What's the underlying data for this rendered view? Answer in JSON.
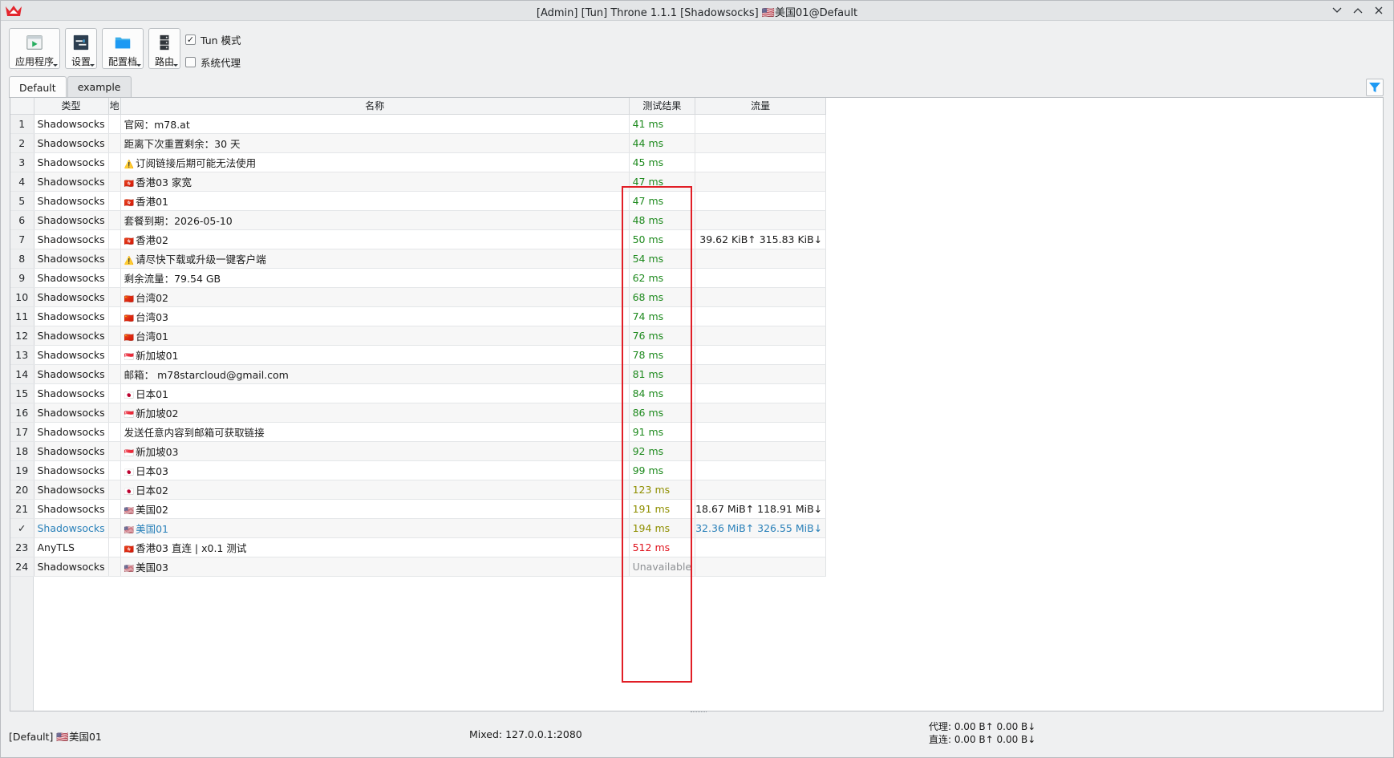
{
  "window": {
    "title": "[Admin] [Tun] Throne 1.1.1 [Shadowsocks] 🇺🇸美国01@Default"
  },
  "toolbar": {
    "buttons": [
      {
        "label": "应用程序",
        "icon": "play-icon"
      },
      {
        "label": "设置",
        "icon": "settings-window-icon"
      },
      {
        "label": "配置档",
        "icon": "folder-icon"
      },
      {
        "label": "路由",
        "icon": "server-icon"
      }
    ],
    "tun_mode": {
      "label": "Tun 模式",
      "checked": true,
      "mark": "✓"
    },
    "system_proxy": {
      "label": "系统代理",
      "checked": false
    }
  },
  "tabs": [
    {
      "label": "Default",
      "active": true
    },
    {
      "label": "example",
      "active": false
    }
  ],
  "table": {
    "headers": [
      "类型",
      "地",
      "名称",
      "测试结果",
      "流量"
    ],
    "rows": [
      {
        "num": "1",
        "type": "Shadowsocks",
        "flag": "",
        "name": "官网：m78.at",
        "latency": "41 ms",
        "level": "good",
        "traffic": ""
      },
      {
        "num": "2",
        "type": "Shadowsocks",
        "flag": "",
        "name": "距离下次重置剩余：30 天",
        "latency": "44 ms",
        "level": "good",
        "traffic": ""
      },
      {
        "num": "3",
        "type": "Shadowsocks",
        "flag": "⚠️",
        "name": "订阅链接后期可能无法使用",
        "latency": "45 ms",
        "level": "good",
        "traffic": ""
      },
      {
        "num": "4",
        "type": "Shadowsocks",
        "flag": "🇭🇰",
        "name": "香港03 家宽",
        "latency": "47 ms",
        "level": "good",
        "traffic": ""
      },
      {
        "num": "5",
        "type": "Shadowsocks",
        "flag": "🇭🇰",
        "name": "香港01",
        "latency": "47 ms",
        "level": "good",
        "traffic": ""
      },
      {
        "num": "6",
        "type": "Shadowsocks",
        "flag": "",
        "name": "套餐到期：2026-05-10",
        "latency": "48 ms",
        "level": "good",
        "traffic": ""
      },
      {
        "num": "7",
        "type": "Shadowsocks",
        "flag": "🇭🇰",
        "name": "香港02",
        "latency": "50 ms",
        "level": "good",
        "traffic": "39.62 KiB↑ 315.83 KiB↓"
      },
      {
        "num": "8",
        "type": "Shadowsocks",
        "flag": "⚠️",
        "name": "请尽快下载或升级一键客户端",
        "latency": "54 ms",
        "level": "good",
        "traffic": ""
      },
      {
        "num": "9",
        "type": "Shadowsocks",
        "flag": "",
        "name": "剩余流量：79.54 GB",
        "latency": "62 ms",
        "level": "good",
        "traffic": ""
      },
      {
        "num": "10",
        "type": "Shadowsocks",
        "flag": "🇨🇳",
        "name": "台湾02",
        "latency": "68 ms",
        "level": "good",
        "traffic": ""
      },
      {
        "num": "11",
        "type": "Shadowsocks",
        "flag": "🇨🇳",
        "name": "台湾03",
        "latency": "74 ms",
        "level": "good",
        "traffic": ""
      },
      {
        "num": "12",
        "type": "Shadowsocks",
        "flag": "🇨🇳",
        "name": "台湾01",
        "latency": "76 ms",
        "level": "good",
        "traffic": ""
      },
      {
        "num": "13",
        "type": "Shadowsocks",
        "flag": "🇸🇬",
        "name": "新加坡01",
        "latency": "78 ms",
        "level": "good",
        "traffic": ""
      },
      {
        "num": "14",
        "type": "Shadowsocks",
        "flag": "",
        "name": "邮箱： m78starcloud@gmail.com",
        "latency": "81 ms",
        "level": "good",
        "traffic": ""
      },
      {
        "num": "15",
        "type": "Shadowsocks",
        "flag": "🇯🇵",
        "name": "日本01",
        "latency": "84 ms",
        "level": "good",
        "traffic": ""
      },
      {
        "num": "16",
        "type": "Shadowsocks",
        "flag": "🇸🇬",
        "name": "新加坡02",
        "latency": "86 ms",
        "level": "good",
        "traffic": ""
      },
      {
        "num": "17",
        "type": "Shadowsocks",
        "flag": "",
        "name": "发送任意内容到邮箱可获取链接",
        "latency": "91 ms",
        "level": "good",
        "traffic": ""
      },
      {
        "num": "18",
        "type": "Shadowsocks",
        "flag": "🇸🇬",
        "name": "新加坡03",
        "latency": "92 ms",
        "level": "good",
        "traffic": ""
      },
      {
        "num": "19",
        "type": "Shadowsocks",
        "flag": "🇯🇵",
        "name": "日本03",
        "latency": "99 ms",
        "level": "good",
        "traffic": ""
      },
      {
        "num": "20",
        "type": "Shadowsocks",
        "flag": "🇯🇵",
        "name": "日本02",
        "latency": "123 ms",
        "level": "mid",
        "traffic": ""
      },
      {
        "num": "21",
        "type": "Shadowsocks",
        "flag": "🇺🇸",
        "name": "美国02",
        "latency": "191 ms",
        "level": "mid",
        "traffic": "18.67 MiB↑ 118.91 MiB↓"
      },
      {
        "num": "✓",
        "type": "Shadowsocks",
        "flag": "🇺🇸",
        "name": "美国01",
        "latency": "194 ms",
        "level": "mid",
        "traffic": "32.36 MiB↑ 326.55 MiB↓",
        "current": true
      },
      {
        "num": "23",
        "type": "AnyTLS",
        "flag": "🇭🇰",
        "name": "香港03 直连 | x0.1 测试",
        "latency": "512 ms",
        "level": "bad",
        "traffic": ""
      },
      {
        "num": "24",
        "type": "Shadowsocks",
        "flag": "🇺🇸",
        "name": "美国03",
        "latency": "Unavailable",
        "level": "na",
        "traffic": ""
      }
    ]
  },
  "statusbar": {
    "current": "[Default] 🇺🇸美国01",
    "mixed": "Mixed: 127.0.0.1:2080",
    "proxy": "代理: 0.00 B↑ 0.00 B↓",
    "direct": "直连: 0.00 B↑ 0.00 B↓"
  },
  "colors": {
    "latency_good": "#1e8a1e",
    "latency_mid": "#8f8f00",
    "latency_bad": "#e0141e",
    "current_row": "#2980b9",
    "highlight_box": "#e11e26"
  }
}
